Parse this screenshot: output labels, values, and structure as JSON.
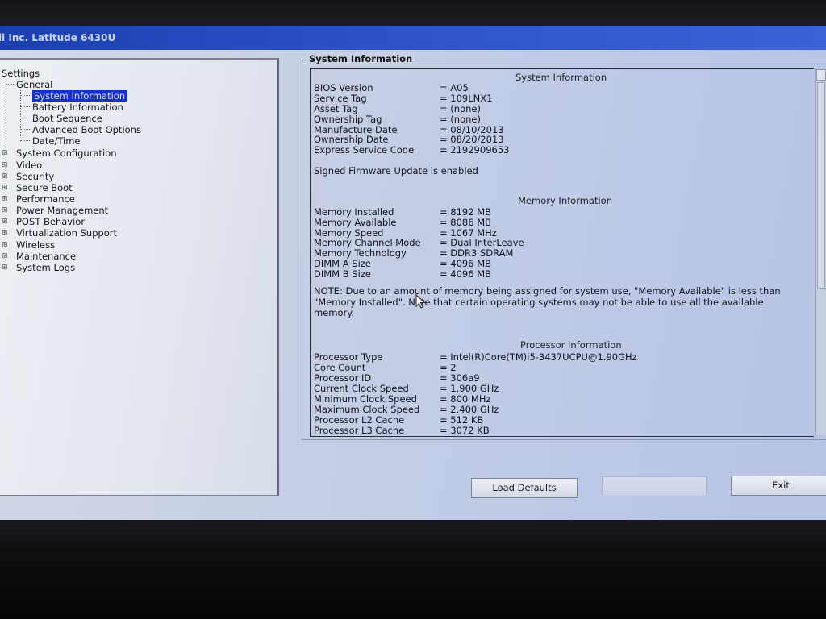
{
  "window": {
    "title": "ll Inc. Latitude 6430U"
  },
  "tree": {
    "root": "Settings",
    "general": {
      "label": "General",
      "children": [
        "System Information",
        "Battery Information",
        "Boot Sequence",
        "Advanced Boot Options",
        "Date/Time"
      ],
      "selected": "System Information"
    },
    "others": [
      "System Configuration",
      "Video",
      "Security",
      "Secure Boot",
      "Performance",
      "Power Management",
      "POST Behavior",
      "Virtualization Support",
      "Wireless",
      "Maintenance",
      "System Logs"
    ]
  },
  "info": {
    "group_title": "System Information",
    "system": {
      "heading": "System Information",
      "rows": [
        {
          "k": "BIOS Version",
          "v": "= A05"
        },
        {
          "k": "Service Tag",
          "v": "= 109LNX1"
        },
        {
          "k": "Asset Tag",
          "v": "= (none)"
        },
        {
          "k": "Ownership Tag",
          "v": "= (none)"
        },
        {
          "k": "Manufacture Date",
          "v": "= 08/10/2013"
        },
        {
          "k": "Ownership Date",
          "v": "= 08/20/2013"
        },
        {
          "k": "Express Service Code",
          "v": "= 2192909653"
        }
      ],
      "firmware": "Signed Firmware Update is enabled"
    },
    "memory": {
      "heading": "Memory Information",
      "rows": [
        {
          "k": "Memory Installed",
          "v": "= 8192 MB"
        },
        {
          "k": "Memory Available",
          "v": "= 8086 MB"
        },
        {
          "k": "Memory Speed",
          "v": "= 1067 MHz"
        },
        {
          "k": "Memory Channel Mode",
          "v": "= Dual InterLeave"
        },
        {
          "k": "Memory Technology",
          "v": "= DDR3 SDRAM"
        },
        {
          "k": "DIMM A Size",
          "v": "= 4096 MB"
        },
        {
          "k": "DIMM B Size",
          "v": "= 4096 MB"
        }
      ],
      "note": "NOTE: Due to an amount of memory being assigned for system use, \"Memory Available\" is less than \"Memory Installed\". Note that certain operating systems may not be able to use all the available memory."
    },
    "processor": {
      "heading": "Processor Information",
      "rows": [
        {
          "k": "Processor Type",
          "v": "= Intel(R)Core(TM)i5-3437UCPU@1.90GHz"
        },
        {
          "k": "Core Count",
          "v": "= 2"
        },
        {
          "k": "Processor ID",
          "v": "= 306a9"
        },
        {
          "k": "Current Clock Speed",
          "v": "= 1.900 GHz"
        },
        {
          "k": "Minimum Clock Speed",
          "v": "= 800 MHz"
        },
        {
          "k": "Maximum Clock Speed",
          "v": "= 2.400 GHz"
        },
        {
          "k": "Processor L2 Cache",
          "v": "= 512 KB"
        },
        {
          "k": "Processor L3 Cache",
          "v": "= 3072 KB"
        }
      ]
    }
  },
  "buttons": {
    "load_defaults": "Load Defaults",
    "apply": "",
    "exit": "Exit"
  },
  "colors": {
    "title_bar": "#2d54c9",
    "selection": "#1730c9"
  }
}
